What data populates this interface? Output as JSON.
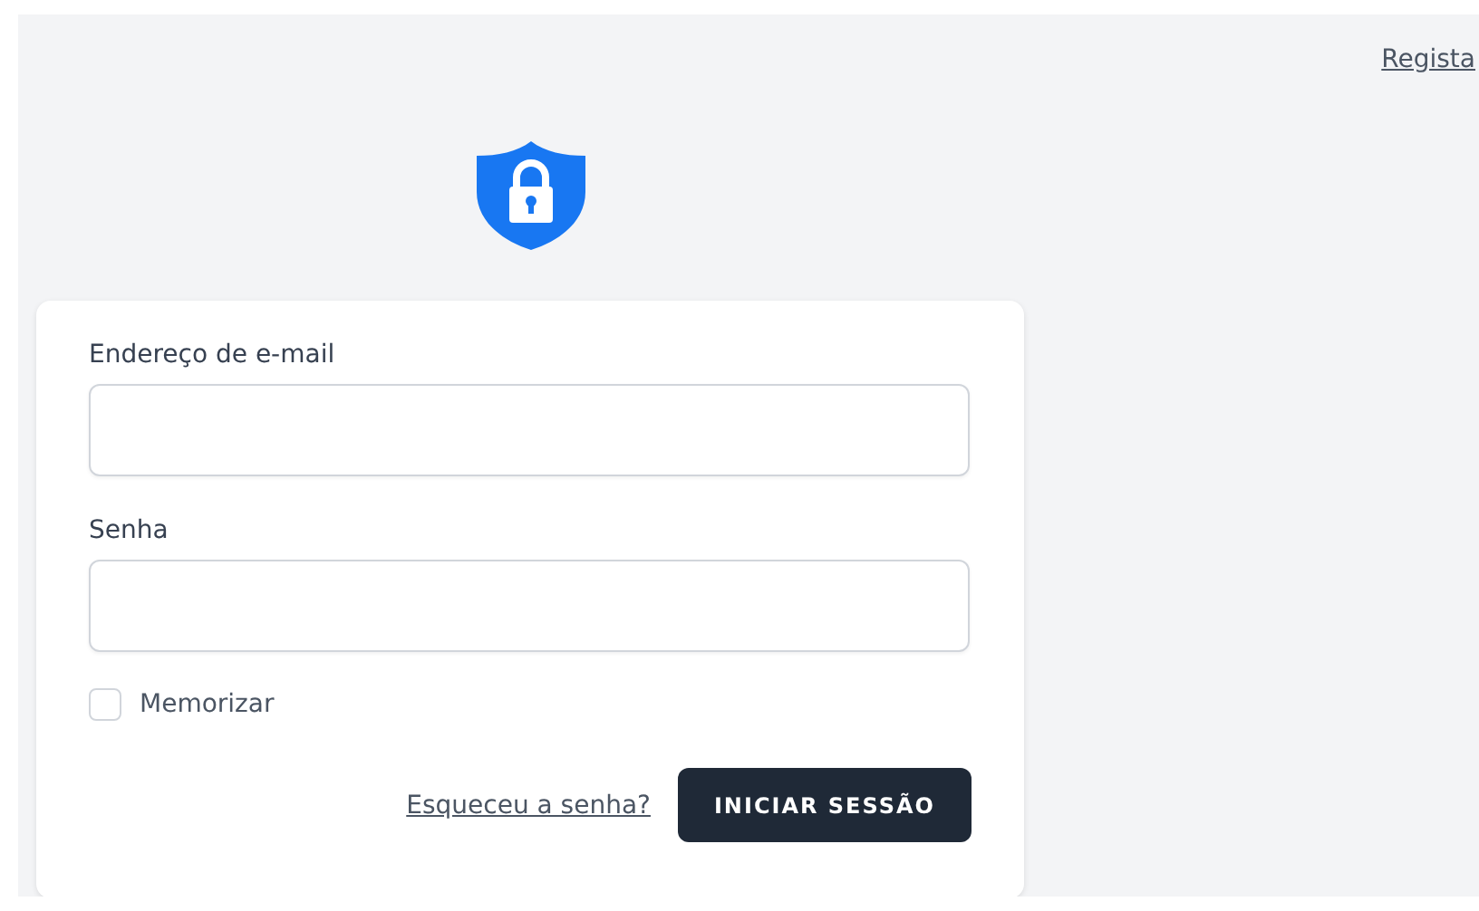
{
  "header_link": "Regista",
  "fields": [
    {
      "label": "Endereço de e-mail"
    },
    {
      "label": "Senha"
    }
  ],
  "remember": {
    "label": "Memorizar",
    "checked": false
  },
  "forgot_link": "Esqueceu a senha?",
  "submit_button": "INICIAR SESSÃO"
}
